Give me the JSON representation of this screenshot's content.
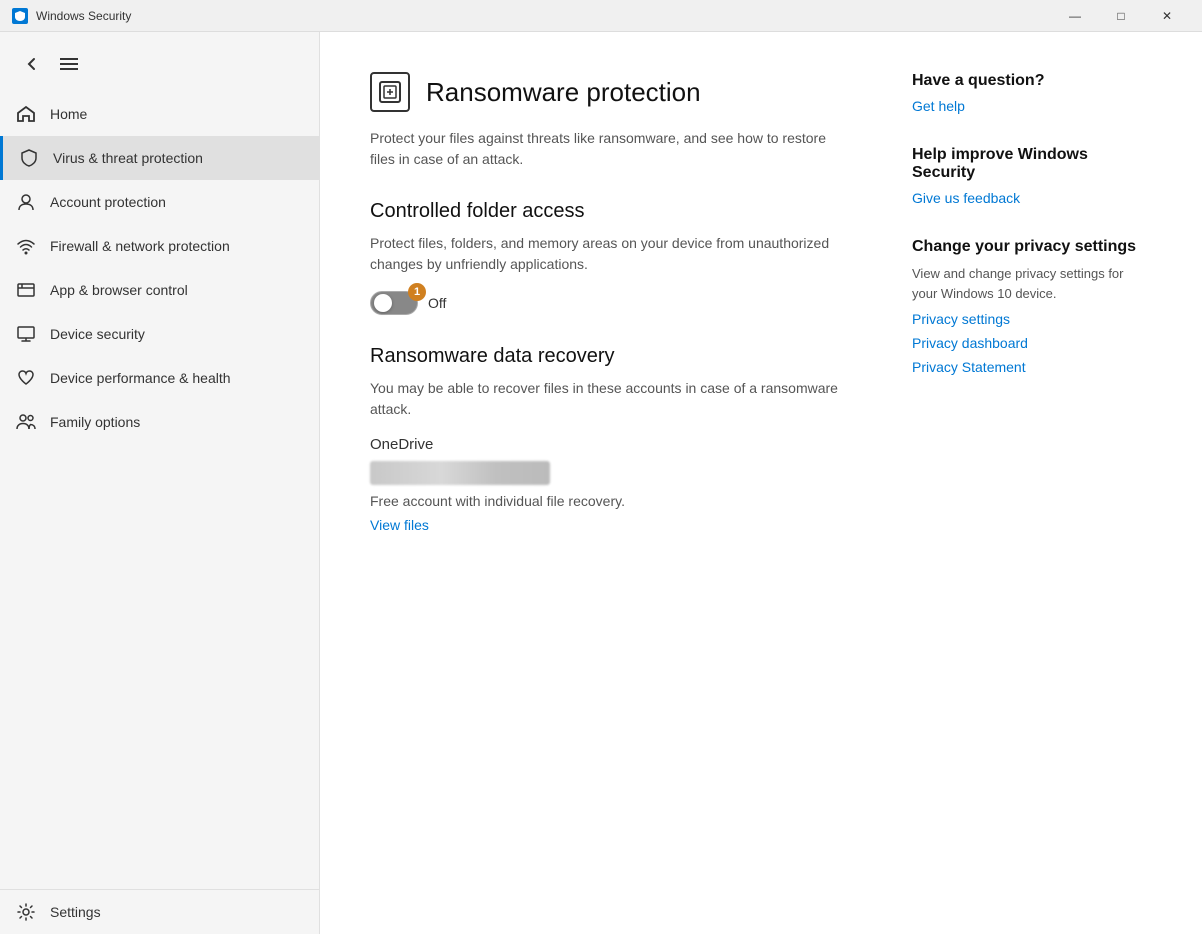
{
  "titlebar": {
    "title": "Windows Security",
    "minimize": "—",
    "maximize": "□",
    "close": "✕"
  },
  "sidebar": {
    "back_label": "←",
    "nav_items": [
      {
        "id": "home",
        "label": "Home",
        "icon": "home-icon"
      },
      {
        "id": "virus",
        "label": "Virus & threat protection",
        "icon": "shield-icon",
        "active": true
      },
      {
        "id": "account",
        "label": "Account protection",
        "icon": "person-icon"
      },
      {
        "id": "firewall",
        "label": "Firewall & network protection",
        "icon": "wifi-icon"
      },
      {
        "id": "appbrowser",
        "label": "App & browser control",
        "icon": "window-icon"
      },
      {
        "id": "devicesecurity",
        "label": "Device security",
        "icon": "computer-icon"
      },
      {
        "id": "devicehealth",
        "label": "Device performance & health",
        "icon": "heart-icon"
      },
      {
        "id": "family",
        "label": "Family options",
        "icon": "family-icon"
      }
    ],
    "settings_label": "Settings"
  },
  "main": {
    "page_title": "Ransomware protection",
    "page_description": "Protect your files against threats like ransomware, and see how to restore files in case of an attack.",
    "controlled_folder": {
      "title": "Controlled folder access",
      "description": "Protect files, folders, and memory areas on your device from unauthorized changes by unfriendly applications.",
      "toggle_state": "Off",
      "toggle_badge": "1"
    },
    "data_recovery": {
      "title": "Ransomware data recovery",
      "description": "You may be able to recover files in these accounts in case of a ransomware attack.",
      "onedrive_label": "OneDrive",
      "account_desc": "Free account with individual file recovery.",
      "view_files_label": "View files"
    }
  },
  "sidebar_right": {
    "question": {
      "heading": "Have a question?",
      "link": "Get help"
    },
    "feedback": {
      "heading": "Help improve Windows Security",
      "link": "Give us feedback"
    },
    "privacy": {
      "heading": "Change your privacy settings",
      "description": "View and change privacy settings for your Windows 10 device.",
      "links": [
        "Privacy settings",
        "Privacy dashboard",
        "Privacy Statement"
      ]
    }
  }
}
